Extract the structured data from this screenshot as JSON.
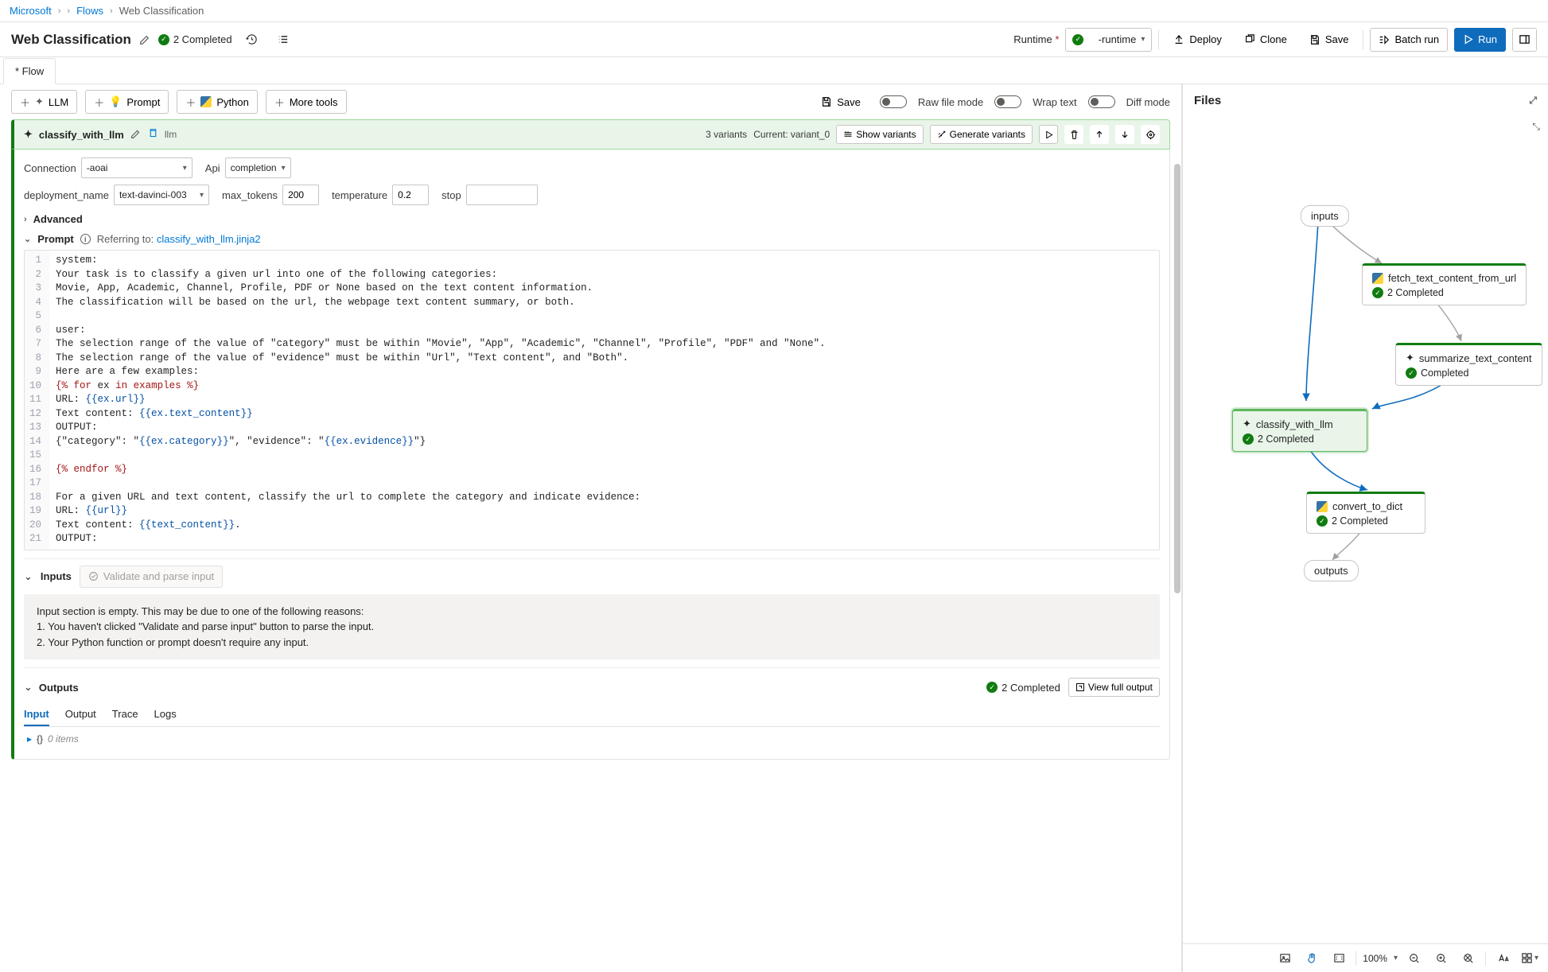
{
  "breadcrumb": {
    "root": "Microsoft",
    "flows": "Flows",
    "current": "Web Classification"
  },
  "header": {
    "title": "Web Classification",
    "status": "2 Completed",
    "runtime_label": "Runtime",
    "runtime_value": "-runtime",
    "deploy": "Deploy",
    "clone": "Clone",
    "save": "Save",
    "batch_run": "Batch run",
    "run": "Run"
  },
  "tabs": {
    "flow": "* Flow"
  },
  "tools": {
    "llm": "LLM",
    "prompt": "Prompt",
    "python": "Python",
    "more": "More tools",
    "save": "Save",
    "raw": "Raw file mode",
    "wrap": "Wrap text",
    "diff": "Diff mode"
  },
  "node": {
    "name": "classify_with_llm",
    "tag": "llm",
    "variants_text": "3 variants",
    "current_text": "Current: variant_0",
    "show_variants": "Show variants",
    "gen_variants": "Generate variants",
    "connection_label": "Connection",
    "connection_value": "-aoai",
    "api_label": "Api",
    "api_value": "completion",
    "deployment_label": "deployment_name",
    "deployment_value": "text-davinci-003",
    "max_tokens_label": "max_tokens",
    "max_tokens_value": "200",
    "temperature_label": "temperature",
    "temperature_value": "0.2",
    "stop_label": "stop",
    "stop_value": "",
    "advanced": "Advanced",
    "prompt": "Prompt",
    "referring": "Referring to:",
    "refer_file": "classify_with_llm.jinja2"
  },
  "code": {
    "l1": "system:",
    "l2": "Your task is to classify a given url into one of the following categories:",
    "l3": "Movie, App, Academic, Channel, Profile, PDF or None based on the text content information.",
    "l4": "The classification will be based on the url, the webpage text content summary, or both.",
    "l5": "",
    "l6": "user:",
    "l7": "The selection range of the value of \"category\" must be within \"Movie\", \"App\", \"Academic\", \"Channel\", \"Profile\", \"PDF\" and \"None\".",
    "l8": "The selection range of the value of \"evidence\" must be within \"Url\", \"Text content\", and \"Both\".",
    "l9": "Here are a few examples:",
    "l10a": "{% ",
    "l10b": "for",
    "l10c": " ex ",
    "l10d": "in",
    "l10e": " examples %}",
    "l11a": "URL: ",
    "l11b": "{{ex.url}}",
    "l12a": "Text content: ",
    "l12b": "{{ex.text_content}}",
    "l13": "OUTPUT:",
    "l14a": "{\"category\": \"",
    "l14b": "{{ex.category}}",
    "l14c": "\", \"evidence\": \"",
    "l14d": "{{ex.evidence}}",
    "l14e": "\"}",
    "l15": "",
    "l16a": "{% ",
    "l16b": "endfor",
    "l16c": " %}",
    "l17": "",
    "l18": "For a given URL and text content, classify the url to complete the category and indicate evidence:",
    "l19a": "URL: ",
    "l19b": "{{url}}",
    "l20a": "Text content: ",
    "l20b": "{{text_content}}",
    "l20c": ".",
    "l21": "OUTPUT:"
  },
  "inputs": {
    "title": "Inputs",
    "validate": "Validate and parse input",
    "msg_head": "Input section is empty. This may be due to one of the following reasons:",
    "msg1": "1. You haven't clicked \"Validate and parse input\" button to parse the input.",
    "msg2": "2. Your Python function or prompt doesn't require any input."
  },
  "outputs": {
    "title": "Outputs",
    "status": "2 Completed",
    "view_full": "View full output",
    "tab_input": "Input",
    "tab_output": "Output",
    "tab_trace": "Trace",
    "tab_logs": "Logs",
    "placeholder": "0 items"
  },
  "files": {
    "title": "Files"
  },
  "graph": {
    "inputs": "inputs",
    "fetch": "fetch_text_content_from_url",
    "fetch_status": "2 Completed",
    "summarize": "summarize_text_content",
    "summarize_status": "Completed",
    "classify": "classify_with_llm",
    "classify_status": "2 Completed",
    "convert": "convert_to_dict",
    "convert_status": "2 Completed",
    "outputs": "outputs"
  },
  "footer": {
    "zoom": "100%"
  }
}
